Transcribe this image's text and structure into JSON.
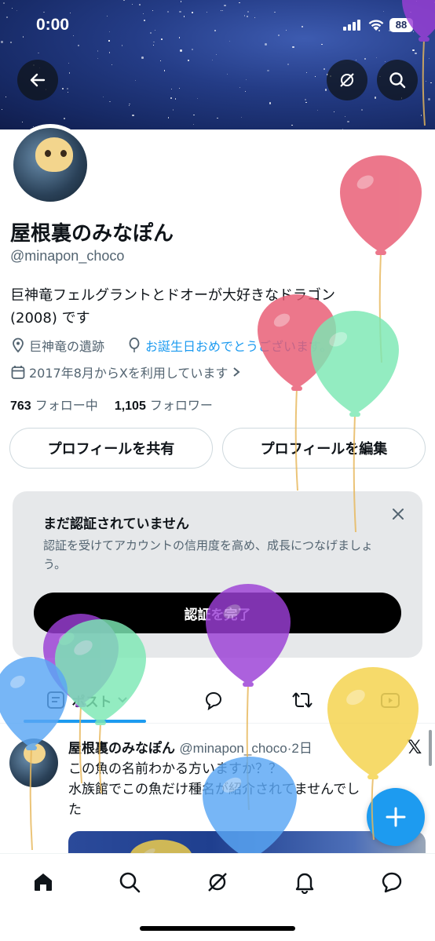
{
  "status": {
    "time": "0:00",
    "battery": "88"
  },
  "profile": {
    "name": "屋根裏のみなぽん",
    "handle": "@minapon_choco",
    "bio_line1": "巨神竜フェルグラントとドオーが大好きなドラゴン",
    "bio_line2": "(2008) です",
    "location": "巨神竜の遺跡",
    "birthday": "お誕生日おめでとうございます。",
    "joined": "2017年8月からXを利用しています",
    "following_count": "763",
    "following_label": "フォロー中",
    "followers_count": "1,105",
    "followers_label": "フォロワー"
  },
  "actions": {
    "share": "プロフィールを共有",
    "edit": "プロフィールを編集"
  },
  "verify_card": {
    "title": "まだ認証されていません",
    "description": "認証を受けてアカウントの信用度を高め、成長につなげましょう。",
    "cta": "認証を完了"
  },
  "tabs": {
    "posts": "ポスト"
  },
  "post": {
    "name": "屋根裏のみなぽん",
    "handle": "@minapon_choco",
    "time": "·2日",
    "text_line1": "この魚の名前わかる方いますか？？",
    "text_line2": "水族館でこの魚だけ種名が紹介されてませんでし",
    "text_line3": "た"
  },
  "colors": {
    "accent": "#1d9bf0",
    "text": "#0f1419",
    "muted": "#536471"
  },
  "icons": [
    "back-arrow-icon",
    "grok-icon",
    "search-icon",
    "location-pin-icon",
    "balloon-icon",
    "calendar-icon",
    "close-icon",
    "posts-icon",
    "reply-icon",
    "repost-icon",
    "video-icon",
    "x-logo-icon",
    "plus-icon",
    "home-icon",
    "bell-icon",
    "chat-icon"
  ]
}
